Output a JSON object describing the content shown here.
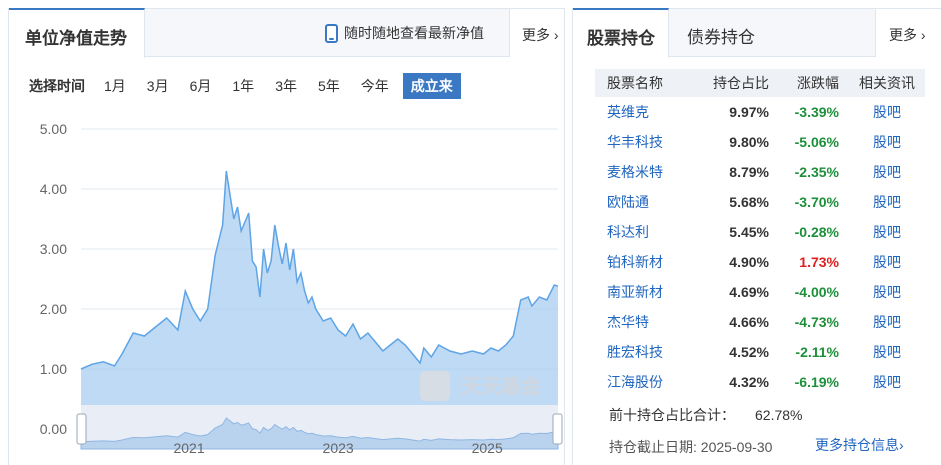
{
  "nav_panel": {
    "tab_title": "单位净值走势",
    "phone_link": "随时随地查看最新净值",
    "more": "更多",
    "range_label": "选择时间",
    "ranges": [
      "1月",
      "3月",
      "6月",
      "1年",
      "3年",
      "5年",
      "今年",
      "成立来"
    ],
    "active_range": "成立来"
  },
  "holdings_panel": {
    "tabs": [
      "股票持仓",
      "债券持仓"
    ],
    "active_tab": "股票持仓",
    "more": "更多",
    "columns": [
      "股票名称",
      "持仓占比",
      "涨跌幅",
      "相关资讯"
    ],
    "rows": [
      {
        "name": "英维克",
        "pct": "9.97%",
        "chg": "-3.39%",
        "dir": "down",
        "link": "股吧"
      },
      {
        "name": "华丰科技",
        "pct": "9.80%",
        "chg": "-5.06%",
        "dir": "down",
        "link": "股吧"
      },
      {
        "name": "麦格米特",
        "pct": "8.79%",
        "chg": "-2.35%",
        "dir": "down",
        "link": "股吧"
      },
      {
        "name": "欧陆通",
        "pct": "5.68%",
        "chg": "-3.70%",
        "dir": "down",
        "link": "股吧"
      },
      {
        "name": "科达利",
        "pct": "5.45%",
        "chg": "-0.28%",
        "dir": "down",
        "link": "股吧"
      },
      {
        "name": "铂科新材",
        "pct": "4.90%",
        "chg": "1.73%",
        "dir": "up",
        "link": "股吧"
      },
      {
        "name": "南亚新材",
        "pct": "4.69%",
        "chg": "-4.00%",
        "dir": "down",
        "link": "股吧"
      },
      {
        "name": "杰华特",
        "pct": "4.66%",
        "chg": "-4.73%",
        "dir": "down",
        "link": "股吧"
      },
      {
        "name": "胜宏科技",
        "pct": "4.52%",
        "chg": "-2.11%",
        "dir": "down",
        "link": "股吧"
      },
      {
        "name": "江海股份",
        "pct": "4.32%",
        "chg": "-6.19%",
        "dir": "down",
        "link": "股吧"
      }
    ],
    "top10_label": "前十持仓占比合计：",
    "top10_value": "62.78%",
    "as_of": "持仓截止日期: 2025-09-30",
    "more_holdings": "更多持仓信息"
  },
  "colors": {
    "accent": "#3a78c3",
    "link": "#2166c0",
    "down": "#1d8f3a",
    "up": "#e02020",
    "area_fill": "#a9cdf0",
    "line": "#5ea4e6"
  },
  "chart_data": {
    "type": "area",
    "ylim": [
      0,
      5
    ],
    "yticks": [
      "5.00",
      "4.00",
      "3.00",
      "2.00",
      "1.00",
      "0.00"
    ],
    "navigator_labels": [
      "2021",
      "2023",
      "2025"
    ],
    "watermark": "天天基金",
    "x": [
      2019.55,
      2019.7,
      2019.85,
      2020.0,
      2020.1,
      2020.25,
      2020.4,
      2020.55,
      2020.7,
      2020.85,
      2020.95,
      2021.05,
      2021.15,
      2021.25,
      2021.35,
      2021.45,
      2021.5,
      2021.6,
      2021.65,
      2021.7,
      2021.8,
      2021.85,
      2021.9,
      2021.95,
      2022.0,
      2022.05,
      2022.1,
      2022.15,
      2022.2,
      2022.25,
      2022.3,
      2022.35,
      2022.4,
      2022.45,
      2022.5,
      2022.55,
      2022.6,
      2022.65,
      2022.7,
      2022.8,
      2022.9,
      2023.0,
      2023.1,
      2023.2,
      2023.3,
      2023.4,
      2023.5,
      2023.6,
      2023.7,
      2023.8,
      2023.9,
      2024.0,
      2024.1,
      2024.15,
      2024.25,
      2024.35,
      2024.5,
      2024.65,
      2024.8,
      2024.95,
      2025.05,
      2025.15,
      2025.25,
      2025.35,
      2025.45,
      2025.55,
      2025.6,
      2025.7,
      2025.8,
      2025.9,
      2025.95
    ],
    "values": [
      1.0,
      1.08,
      1.12,
      1.05,
      1.25,
      1.6,
      1.55,
      1.7,
      1.85,
      1.65,
      2.3,
      2.0,
      1.8,
      2.0,
      2.9,
      3.4,
      4.3,
      3.5,
      3.7,
      3.3,
      3.6,
      2.8,
      2.7,
      2.2,
      3.0,
      2.6,
      2.8,
      3.4,
      3.05,
      2.75,
      3.1,
      2.65,
      3.0,
      2.45,
      2.6,
      2.3,
      2.1,
      2.2,
      2.0,
      1.8,
      1.85,
      1.65,
      1.55,
      1.75,
      1.5,
      1.6,
      1.45,
      1.3,
      1.4,
      1.5,
      1.4,
      1.25,
      1.1,
      1.35,
      1.2,
      1.4,
      1.3,
      1.25,
      1.3,
      1.25,
      1.35,
      1.3,
      1.4,
      1.55,
      2.15,
      2.2,
      2.05,
      2.2,
      2.15,
      2.4,
      2.38
    ]
  }
}
